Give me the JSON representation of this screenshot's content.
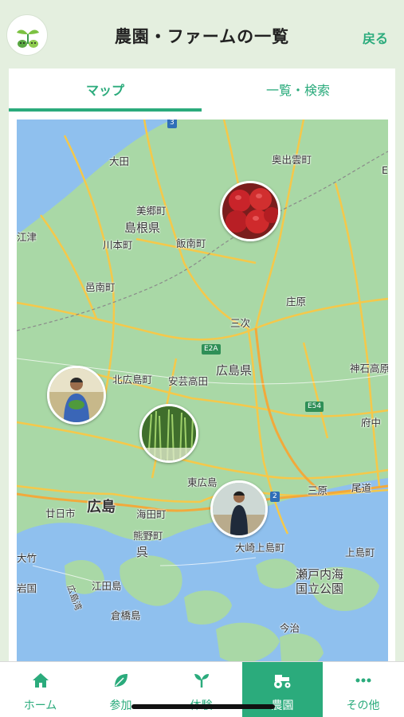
{
  "header": {
    "title": "農園・ファームの一覧",
    "back_label": "戻る",
    "logo_icon": "sprout-logo-icon"
  },
  "tabs": [
    {
      "label": "マップ",
      "active": true
    },
    {
      "label": "一覧・検索",
      "active": false
    }
  ],
  "map": {
    "places": {
      "ohda": "大田",
      "okuizumo": "奥出雲町",
      "misato": "美郷町",
      "shimane": "島根県",
      "gotsu": "江津",
      "kawamoto": "川本町",
      "iinan": "飯南町",
      "oonan": "邑南町",
      "shobara": "庄原",
      "miyoshi": "三次",
      "jinsekikogen": "神石高原",
      "kitahiroshima": "北広島町",
      "akitakata": "安芸高田",
      "hiroshimaken": "広島県",
      "fuchu": "府中",
      "higashihiroshima": "東広島",
      "mihara": "三原",
      "onomichi": "尾道",
      "hatsukaichi": "廿日市",
      "hiroshima": "広島",
      "kaitaichi": "海田町",
      "kumano": "熊野町",
      "kure": "呉",
      "osakikamijima": "大崎上島町",
      "kamijima": "上島町",
      "otake": "大竹",
      "iwakuni": "岩国",
      "etajima": "江田島",
      "setonaikai": "瀬戸内海",
      "kokuritsu": "国立公園",
      "kurahashi": "倉橋島",
      "imabari": "今治",
      "hiroshimabay": "広島湾",
      "e_label": "E"
    },
    "roads": {
      "e2a": "E2A",
      "e54": "E54",
      "r2": "2",
      "r3": "3"
    },
    "markers": [
      {
        "name": "apple-farm-marker",
        "subject": "apples"
      },
      {
        "name": "farmer-with-vegetables-marker",
        "subject": "farmer"
      },
      {
        "name": "green-onion-farm-marker",
        "subject": "green onions"
      },
      {
        "name": "farmer-standing-marker",
        "subject": "farmer"
      }
    ]
  },
  "bottom_nav": [
    {
      "label": "ホーム",
      "icon": "home-icon",
      "active": false
    },
    {
      "label": "参加",
      "icon": "leaf-icon",
      "active": false
    },
    {
      "label": "体験",
      "icon": "sprout-icon",
      "active": false
    },
    {
      "label": "農園",
      "icon": "tractor-icon",
      "active": true
    },
    {
      "label": "その他",
      "icon": "more-icon",
      "active": false
    }
  ],
  "colors": {
    "accent": "#2bab7c",
    "background": "#e4efdf",
    "land": "#a9d8a6",
    "sea": "#8fc0ee",
    "roads": "#f5c84a"
  }
}
